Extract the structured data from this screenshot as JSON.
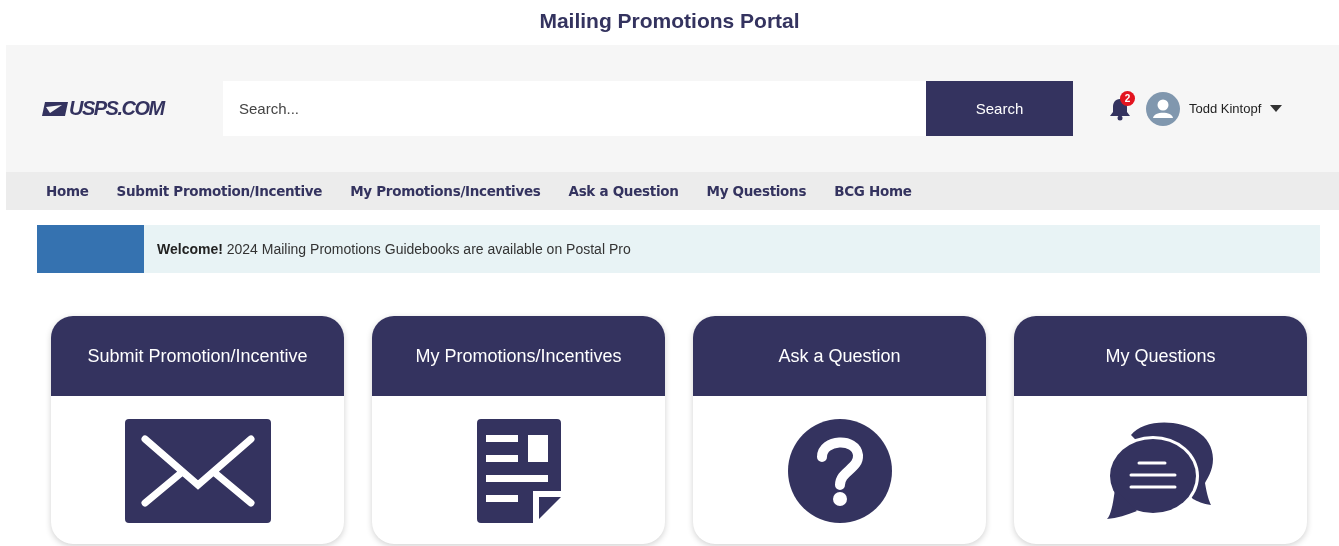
{
  "page_title": "Mailing Promotions Portal",
  "header": {
    "logo": "USPS.COM",
    "search": {
      "placeholder": "Search...",
      "button": "Search"
    },
    "notifications": {
      "count": "2"
    },
    "user": {
      "name": "Todd Kintopf"
    }
  },
  "nav": [
    {
      "label": "Home"
    },
    {
      "label": "Submit Promotion/Incentive"
    },
    {
      "label": "My Promotions/Incentives"
    },
    {
      "label": "Ask a Question"
    },
    {
      "label": "My Questions"
    },
    {
      "label": "BCG Home"
    }
  ],
  "banner": {
    "text": "**Welcome!** 2024 Mailing Promotions Guidebooks are available on Postal Pro"
  },
  "cards": [
    {
      "title": "Submit Promotion/Incentive",
      "kind": "envelope"
    },
    {
      "title": "My Promotions/Incentives",
      "kind": "document"
    },
    {
      "title": "Ask a Question",
      "kind": "question"
    },
    {
      "title": "My Questions",
      "kind": "chat"
    }
  ]
}
